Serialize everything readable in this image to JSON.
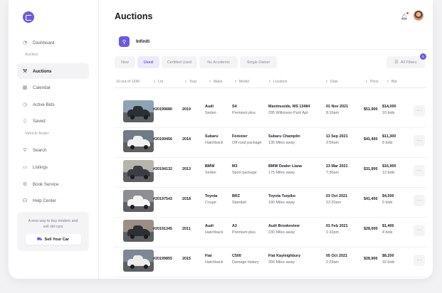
{
  "header": {
    "title": "Auctions"
  },
  "sidebar": {
    "items": [
      {
        "label": "Dashboard",
        "icon": "speedometer-icon",
        "glyph": "◔"
      },
      {
        "label": "Auction",
        "section": true
      },
      {
        "label": "Auctions",
        "icon": "gavel-icon",
        "glyph": "⚒",
        "active": true
      },
      {
        "label": "Calendar",
        "icon": "calendar-icon",
        "glyph": "▦"
      },
      {
        "label": "Active Bids",
        "icon": "clock-icon",
        "glyph": "◷"
      },
      {
        "label": "Saved",
        "icon": "bookmark-icon",
        "glyph": "▯"
      },
      {
        "label": "Vehicle finder",
        "section": true
      },
      {
        "label": "Search",
        "icon": "search-icon",
        "glyph": "⚲"
      },
      {
        "label": "Listings",
        "icon": "laptop-icon",
        "glyph": "▭"
      },
      {
        "label": "Book Service",
        "icon": "gear-icon",
        "glyph": "⚙"
      },
      {
        "label": "Help Center",
        "icon": "headset-icon",
        "glyph": "☊"
      }
    ],
    "promo": {
      "text": "A new way to buy modern and sell old cars",
      "button": "Sell Your Car",
      "icon": "car-sale-icon"
    }
  },
  "search": {
    "value": "Infiniti",
    "icon": "search-icon"
  },
  "filters": {
    "chips": [
      "New",
      "Used",
      "Certified Used",
      "No Accidents",
      "Single Owner"
    ],
    "active": "Used",
    "all_label": "All Filters",
    "badge": "5"
  },
  "table": {
    "count": "10 out of 1240",
    "columns": [
      "Lot",
      "Year",
      "Make",
      "Model",
      "Location",
      "Date",
      "Price",
      "Bid"
    ],
    "rows": [
      {
        "lot": "#20199680",
        "year": "2019",
        "make": "Audi",
        "body": "Sedan",
        "model": "S4",
        "package": "Premium plus",
        "location": "Maximuside, MS 13484",
        "loc_detail": "295 Wilkinson Park Apt.",
        "date": "01 Nov 2021",
        "time": "8:16am",
        "price": "$51,900",
        "bid": "$14,000",
        "bids": "10 bids",
        "car_color": "#2b2f36",
        "bg": "#8ea3b3"
      },
      {
        "lot": "#20199456",
        "year": "2014",
        "make": "Subaru",
        "body": "Hatchback",
        "model": "Forester",
        "package": "Off-road package",
        "location": "Subaru Champlin",
        "loc_detail": "135 Miles away",
        "date": "11 Sep 2021",
        "time": "3:56am",
        "price": "$41,400",
        "bid": "$11,300",
        "bids": "8 bids",
        "car_color": "#f1f1f1",
        "bg": "#6f7c86"
      },
      {
        "lot": "#20194132",
        "year": "2013",
        "make": "BMW",
        "body": "Sedan",
        "model": "M3",
        "package": "Sport package",
        "location": "BMW Dealer Liana",
        "loc_detail": "175 Miles away",
        "date": "23 Mar 2021",
        "time": "7:36am",
        "price": "$31,900",
        "bid": "$16,900",
        "bids": "12 bids",
        "car_color": "#3a3d44",
        "bg": "#b7b4ac"
      },
      {
        "lot": "#20197543",
        "year": "2018",
        "make": "Toyota",
        "body": "Coupe",
        "model": "BRZ",
        "package": "Standart",
        "location": "Toyota Turpiko",
        "loc_detail": "190 Miles away",
        "date": "03 Oct 2021",
        "time": "12:20am",
        "price": "$41,400",
        "bid": "$4,500",
        "bids": "5 bids",
        "car_color": "#f5f5f5",
        "bg": "#8d8f92"
      },
      {
        "lot": "#20191345",
        "year": "2011",
        "make": "Audi",
        "body": "Hatchback",
        "model": "A3",
        "package": "Premium plus",
        "location": "Audi Brookeview",
        "loc_detail": "230 Miles away",
        "date": "01 Feb 2021",
        "time": "1:32pm",
        "price": "$28,000",
        "bid": "$1,400",
        "bids": "4 bids",
        "car_color": "#2d2f33",
        "bg": "#9a8f86"
      },
      {
        "lot": "#20199855",
        "year": "2015",
        "make": "Fiat",
        "body": "Hatchback",
        "model": "C500",
        "package": "Damage history",
        "location": "Fiat Kayleighbury",
        "loc_detail": "256 Miles away",
        "date": "05 Oct 2021",
        "time": "2:29am",
        "price": "$28,900",
        "bid": "$8,200",
        "bids": "32 bids",
        "car_color": "#ececec",
        "bg": "#7d8894"
      }
    ]
  }
}
